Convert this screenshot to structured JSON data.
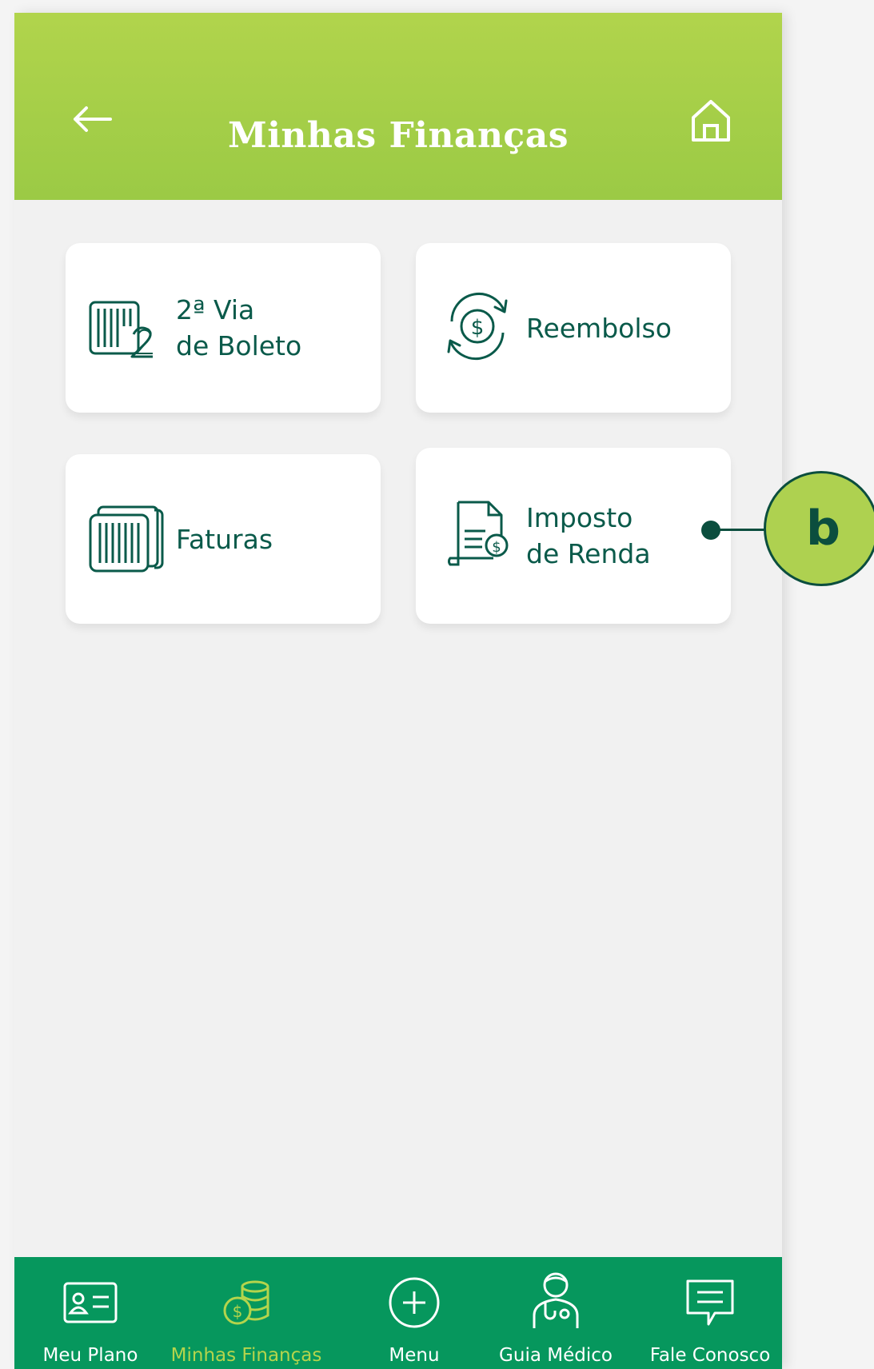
{
  "header": {
    "title": "Minhas Finanças",
    "back_icon": "arrow-left-icon",
    "home_icon": "home-icon"
  },
  "cards": [
    {
      "line1": "2ª Via",
      "line2": "de Boleto",
      "icon": "barcode-2-icon"
    },
    {
      "line1": "Reembolso",
      "line2": "",
      "icon": "refund-cycle-dollar-icon"
    },
    {
      "line1": "Faturas",
      "line2": "",
      "icon": "barcode-stack-icon"
    },
    {
      "line1": "Imposto",
      "line2": "de Renda",
      "icon": "tax-document-dollar-icon"
    }
  ],
  "callout": {
    "letter": "b"
  },
  "nav": {
    "items": [
      {
        "label": "Meu Plano",
        "icon": "id-card-icon"
      },
      {
        "label": "Minhas Finanças",
        "icon": "coins-icon"
      },
      {
        "label": "Menu",
        "icon": "plus-circle-icon"
      },
      {
        "label": "Guia Médico",
        "icon": "doctor-icon"
      },
      {
        "label": "Fale Conosco",
        "icon": "chat-icon"
      }
    ],
    "active_index": 1
  },
  "colors": {
    "header": "#a8d04a",
    "nav": "#06975d",
    "text_dark": "#0a5a4a",
    "active": "#b4d44c"
  }
}
